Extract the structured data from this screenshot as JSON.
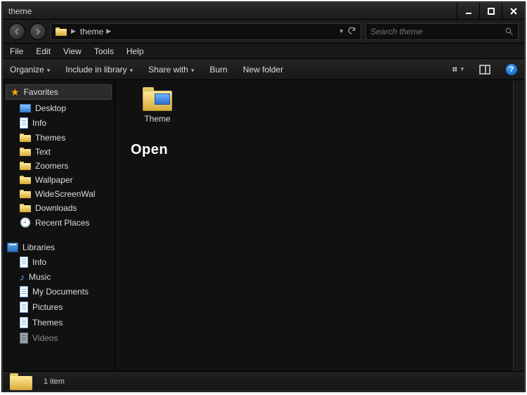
{
  "window": {
    "title": "theme"
  },
  "nav": {
    "breadcrumb": [
      "theme"
    ],
    "search_placeholder": "Search theme"
  },
  "menu": {
    "items": [
      "File",
      "Edit",
      "View",
      "Tools",
      "Help"
    ]
  },
  "toolbar": {
    "organize": "Organize",
    "include": "Include in library",
    "share": "Share with",
    "burn": "Burn",
    "newfolder": "New folder"
  },
  "tree": {
    "favorites_label": "Favorites",
    "favorites": [
      {
        "icon": "desktop",
        "label": "Desktop"
      },
      {
        "icon": "doc",
        "label": "Info"
      },
      {
        "icon": "folder",
        "label": "Themes"
      },
      {
        "icon": "folder",
        "label": "Text"
      },
      {
        "icon": "folder",
        "label": "Zoomers"
      },
      {
        "icon": "folder",
        "label": "Wallpaper"
      },
      {
        "icon": "folder",
        "label": "WideScreenWal"
      },
      {
        "icon": "dl",
        "label": "Downloads"
      },
      {
        "icon": "recent",
        "label": "Recent Places"
      }
    ],
    "libraries_label": "Libraries",
    "libraries": [
      {
        "icon": "doc",
        "label": "Info"
      },
      {
        "icon": "music",
        "label": "Music"
      },
      {
        "icon": "doc",
        "label": "My Documents"
      },
      {
        "icon": "doc",
        "label": "Pictures"
      },
      {
        "icon": "doc",
        "label": "Themes"
      },
      {
        "icon": "doc",
        "label": "Videos"
      }
    ]
  },
  "content": {
    "items": [
      {
        "label": "Theme"
      }
    ],
    "context_text": "Open"
  },
  "status": {
    "count_text": "1 item"
  }
}
